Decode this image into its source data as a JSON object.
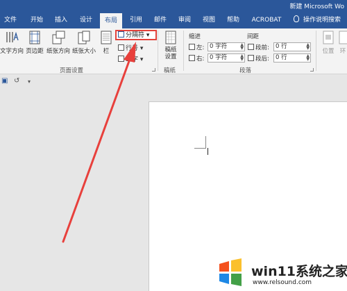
{
  "title_bar": {
    "title": "新建 Microsoft Wo"
  },
  "tabs": [
    {
      "label": "文件"
    },
    {
      "label": "开始"
    },
    {
      "label": "插入"
    },
    {
      "label": "设计"
    },
    {
      "label": "布局",
      "active": true
    },
    {
      "label": "引用"
    },
    {
      "label": "邮件"
    },
    {
      "label": "审阅"
    },
    {
      "label": "视图"
    },
    {
      "label": "帮助"
    },
    {
      "label": "ACROBAT"
    }
  ],
  "tell_me": "操作说明搜索",
  "ribbon": {
    "page_setup": {
      "text_direction": "文字方向",
      "margins": "页边距",
      "orientation": "纸张方向",
      "size": "纸张大小",
      "columns": "栏",
      "breaks": "分隔符",
      "line_numbers": "行号",
      "hyphenation": "断字",
      "group_label": "页面设置"
    },
    "manuscript": {
      "setup_line1": "稿纸",
      "setup_line2": "设置",
      "group_label": "稿纸"
    },
    "paragraph": {
      "indent_header": "缩进",
      "spacing_header": "间距",
      "left_label": "左:",
      "left_value": "0 字符",
      "right_label": "右:",
      "right_value": "0 字符",
      "before_label": "段前:",
      "before_value": "0 行",
      "after_label": "段后:",
      "after_value": "0 行",
      "group_label": "段落"
    },
    "arrange": {
      "position": "位置",
      "wrap": "环"
    }
  },
  "watermark": {
    "title": "win11系统之家",
    "url": "www.relsound.com"
  },
  "colors": {
    "brand": "#2b579a",
    "highlight": "#e2423b"
  }
}
